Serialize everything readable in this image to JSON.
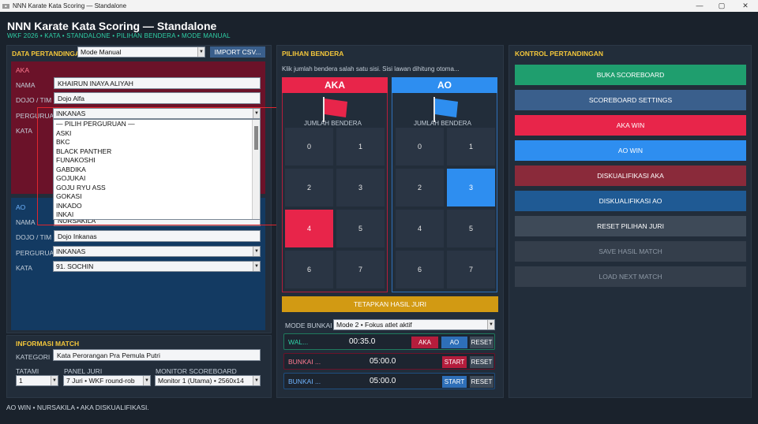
{
  "window": {
    "title": "NNN Karate Kata Scoring — Standalone",
    "icon": "app-icon",
    "minimize": "—",
    "maximize": "▢",
    "close": "✕"
  },
  "header": {
    "title": "NNN Karate Kata Scoring — Standalone",
    "subtitle": "WKF 2026 • KATA • STANDALONE • PILIHAN BENDERA • MODE MANUAL"
  },
  "data_pertandingan": {
    "title": "DATA PERTANDINGAN",
    "mode_select": "Mode Manual",
    "import_button": "IMPORT CSV...",
    "aka": {
      "label": "AKA",
      "nama_label": "NAMA",
      "nama": "KHAIRUN INAYA ALIYAH",
      "dojo_label": "DOJO / TIM",
      "dojo": "Dojo Alfa",
      "perguruan_label": "PERGURUAN",
      "perguruan": "INKANAS",
      "kata_label": "KATA"
    },
    "dropdown_options": [
      "— PILIH PERGURUAN —",
      "ASKI",
      "BKC",
      "BLACK PANTHER",
      "FUNAKOSHI",
      "GABDIKA",
      "GOJUKAI",
      "GOJU RYU ASS",
      "GOKASI",
      "INKADO",
      "INKAI"
    ],
    "ao": {
      "label": "AO",
      "nama_label": "NAMA",
      "nama": "NURSAKILA",
      "dojo_label": "DOJO / TIM",
      "dojo": "Dojo Inkanas",
      "perguruan_label": "PERGURUAN",
      "perguruan": "INKANAS",
      "kata_label": "KATA",
      "kata": "91. SOCHIN"
    }
  },
  "informasi_match": {
    "title": "INFORMASI MATCH",
    "kategori_label": "KATEGORI",
    "kategori": "Kata Perorangan Pra Pemula Putri",
    "tatami_label": "TATAMI",
    "tatami": "1",
    "panel_label": "PANEL JURI",
    "panel": "7 Juri • WKF round-rob",
    "monitor_label": "MONITOR SCOREBOARD",
    "monitor": "Monitor 1 (Utama) • 2560x14"
  },
  "pilihan_bendera": {
    "title": "PILIHAN BENDERA",
    "hint": "Klik jumlah bendera salah satu sisi. Sisi lawan dihitung otoma...",
    "aka_header": "AKA",
    "ao_header": "AO",
    "jumlah_label": "JUMLAH BENDERA",
    "numbers": [
      "0",
      "1",
      "2",
      "3",
      "4",
      "5",
      "6",
      "7"
    ],
    "aka_selected": 4,
    "ao_selected": 3,
    "tetapkan": "TETAPKAN HASIL JURI",
    "mode_bunkai_label": "MODE BUNKAI",
    "mode_bunkai": "Mode 2 • Fokus atlet aktif",
    "timers": [
      {
        "label": "WAL...",
        "value": "00:35.0",
        "btn1": "AKA",
        "btn2": "AO",
        "btn3": "RESET"
      },
      {
        "label": "BUNKAI ...",
        "value": "05:00.0",
        "btn1": "START",
        "btn2": "RESET"
      },
      {
        "label": "BUNKAI ...",
        "value": "05:00.0",
        "btn1": "START",
        "btn2": "RESET"
      }
    ]
  },
  "kontrol": {
    "title": "KONTROL PERTANDINGAN",
    "buttons": [
      "BUKA SCOREBOARD",
      "SCOREBOARD SETTINGS",
      "AKA WIN",
      "AO WIN",
      "DISKUALIFIKASI AKA",
      "DISKUALIFIKASI AO",
      "RESET PILIHAN JURI",
      "SAVE HASIL MATCH",
      "LOAD NEXT MATCH"
    ]
  },
  "status": "AO WIN • NURSAKILA • AKA DISKUALIFIKASI.",
  "colors": {
    "aka": "#e8254a",
    "ao": "#2e8ef0",
    "gold": "#d29a13",
    "green": "#1f9e6e",
    "steel": "#3a5f8c"
  }
}
